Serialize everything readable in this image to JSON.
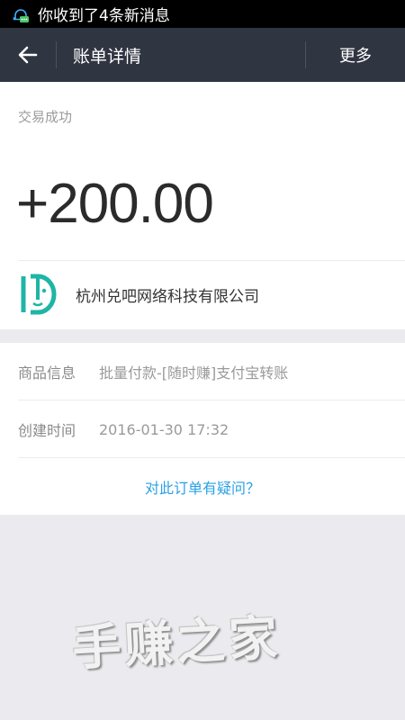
{
  "status_bar": {
    "notification_icon": "bell-chat-icon",
    "notification_text": "你收到了4条新消息"
  },
  "nav": {
    "back_icon": "arrow-left-icon",
    "title": "账单详情",
    "more_label": "更多"
  },
  "transaction": {
    "status": "交易成功",
    "amount": "+200.00",
    "merchant_logo": "merchant-logo-icon",
    "merchant_name": "杭州兑吧网络科技有限公司"
  },
  "details": {
    "goods_label": "商品信息",
    "goods_value": "批量付款-[随时赚]支付宝转账",
    "time_label": "创建时间",
    "time_value": "2016-01-30 17:32",
    "query_link": "对此订单有疑问？"
  },
  "watermark": "手赚之家",
  "colors": {
    "nav_bg": "#2f3541",
    "link": "#2aa0e6",
    "logo": "#1fb5a6",
    "page_bg": "#ebebef"
  }
}
